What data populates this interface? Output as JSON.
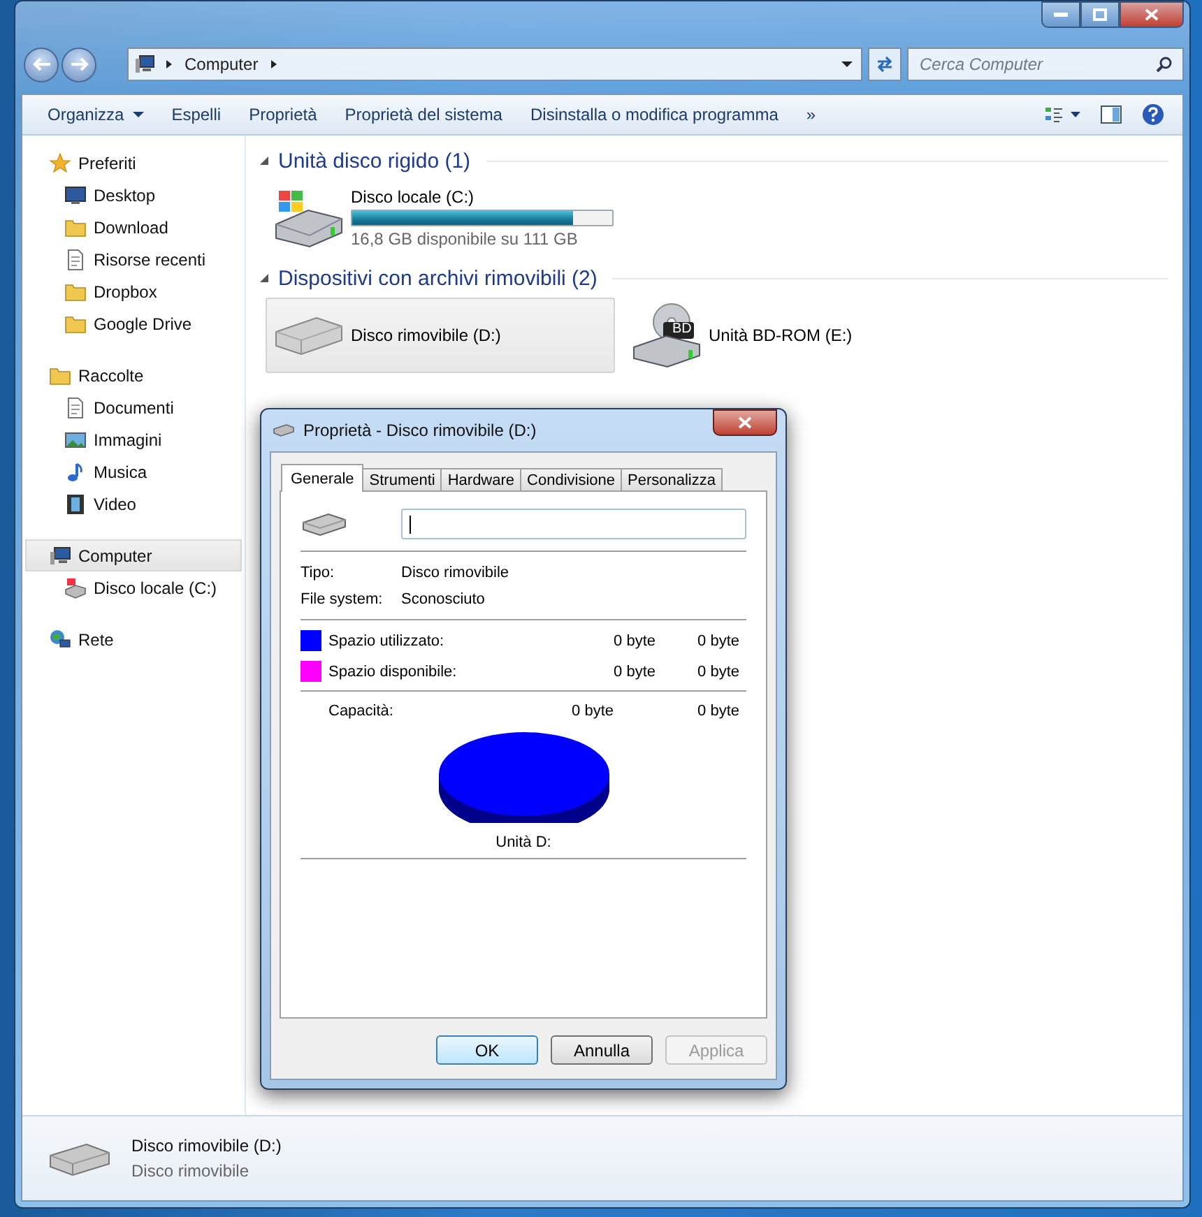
{
  "address_bar": {
    "path": [
      "Computer"
    ]
  },
  "search": {
    "placeholder": "Cerca Computer"
  },
  "toolbar": {
    "items": [
      {
        "kind": "menu",
        "label": "Organizza"
      },
      {
        "kind": "button",
        "label": "Espelli"
      },
      {
        "kind": "button",
        "label": "Proprietà"
      },
      {
        "kind": "button",
        "label": "Proprietà del sistema"
      },
      {
        "kind": "button",
        "label": "Disinstalla o modifica programma"
      },
      {
        "kind": "button",
        "label": "»"
      }
    ]
  },
  "sidebar": {
    "groups": [
      {
        "label": "Preferiti",
        "kind": "star",
        "selected": false,
        "children": [
          {
            "label": "Desktop",
            "kind": "monitor",
            "selected": false
          },
          {
            "label": "Download",
            "kind": "folder",
            "selected": false
          },
          {
            "label": "Risorse recenti",
            "kind": "document",
            "selected": false
          },
          {
            "label": "Dropbox",
            "kind": "folder",
            "selected": false
          },
          {
            "label": "Google Drive",
            "kind": "folder",
            "selected": false
          }
        ]
      },
      {
        "label": "Raccolte",
        "kind": "folder",
        "selected": false,
        "children": [
          {
            "label": "Documenti",
            "kind": "document",
            "selected": false
          },
          {
            "label": "Immagini",
            "kind": "image",
            "selected": false
          },
          {
            "label": "Musica",
            "kind": "note",
            "selected": false
          },
          {
            "label": "Video",
            "kind": "film",
            "selected": false
          }
        ]
      },
      {
        "label": "Computer",
        "kind": "computer",
        "selected": true,
        "children": [
          {
            "label": "Disco locale (C:)",
            "kind": "drive",
            "selected": false
          }
        ]
      },
      {
        "label": "Rete",
        "kind": "globe",
        "selected": false
      }
    ]
  },
  "sections": [
    {
      "title": "Unità disco rigido (1)",
      "expanded": true,
      "items": [
        {
          "kind": "hdd",
          "name": "Disco locale (C:)",
          "level": 0.85,
          "reading": "16,8 GB disponibile su 111 GB",
          "selected": false
        }
      ]
    },
    {
      "title": "Dispositivi con archivi rimovibili (2)",
      "expanded": true,
      "items": [
        {
          "kind": "removable",
          "name": "Disco rimovibile (D:)",
          "selected": true
        },
        {
          "kind": "optical",
          "badge": "BD",
          "name": "Unità BD-ROM (E:)",
          "selected": false
        }
      ]
    }
  ],
  "details_pane": {
    "name": "Disco rimovibile (D:)",
    "type": "Disco rimovibile"
  },
  "dialog": {
    "title": "Proprietà - Disco rimovibile (D:)",
    "tabs": [
      {
        "label": "Generale",
        "selected": true
      },
      {
        "label": "Strumenti",
        "selected": false
      },
      {
        "label": "Hardware",
        "selected": false
      },
      {
        "label": "Condivisione",
        "selected": false
      },
      {
        "label": "Personalizza",
        "selected": false
      }
    ],
    "info": [
      {
        "label": "Tipo:",
        "value": "Disco rimovibile"
      },
      {
        "label": "File system:",
        "value": "Sconosciuto"
      }
    ],
    "space": [
      {
        "label": "Spazio utilizzato:",
        "color": "#0000ff",
        "bytes": "0 byte",
        "size": "0 byte"
      },
      {
        "label": "Spazio disponibile:",
        "color": "#ff00ff",
        "bytes": "0 byte",
        "size": "0 byte"
      }
    ],
    "capacity": {
      "label": "Capacità:",
      "bytes": "0 byte",
      "size": "0 byte"
    },
    "drive_label": "Unità D:",
    "buttons": [
      {
        "label": "OK",
        "default": true,
        "disabled": false
      },
      {
        "label": "Annulla",
        "default": false,
        "disabled": false
      },
      {
        "label": "Applica",
        "default": false,
        "disabled": true
      }
    ]
  }
}
